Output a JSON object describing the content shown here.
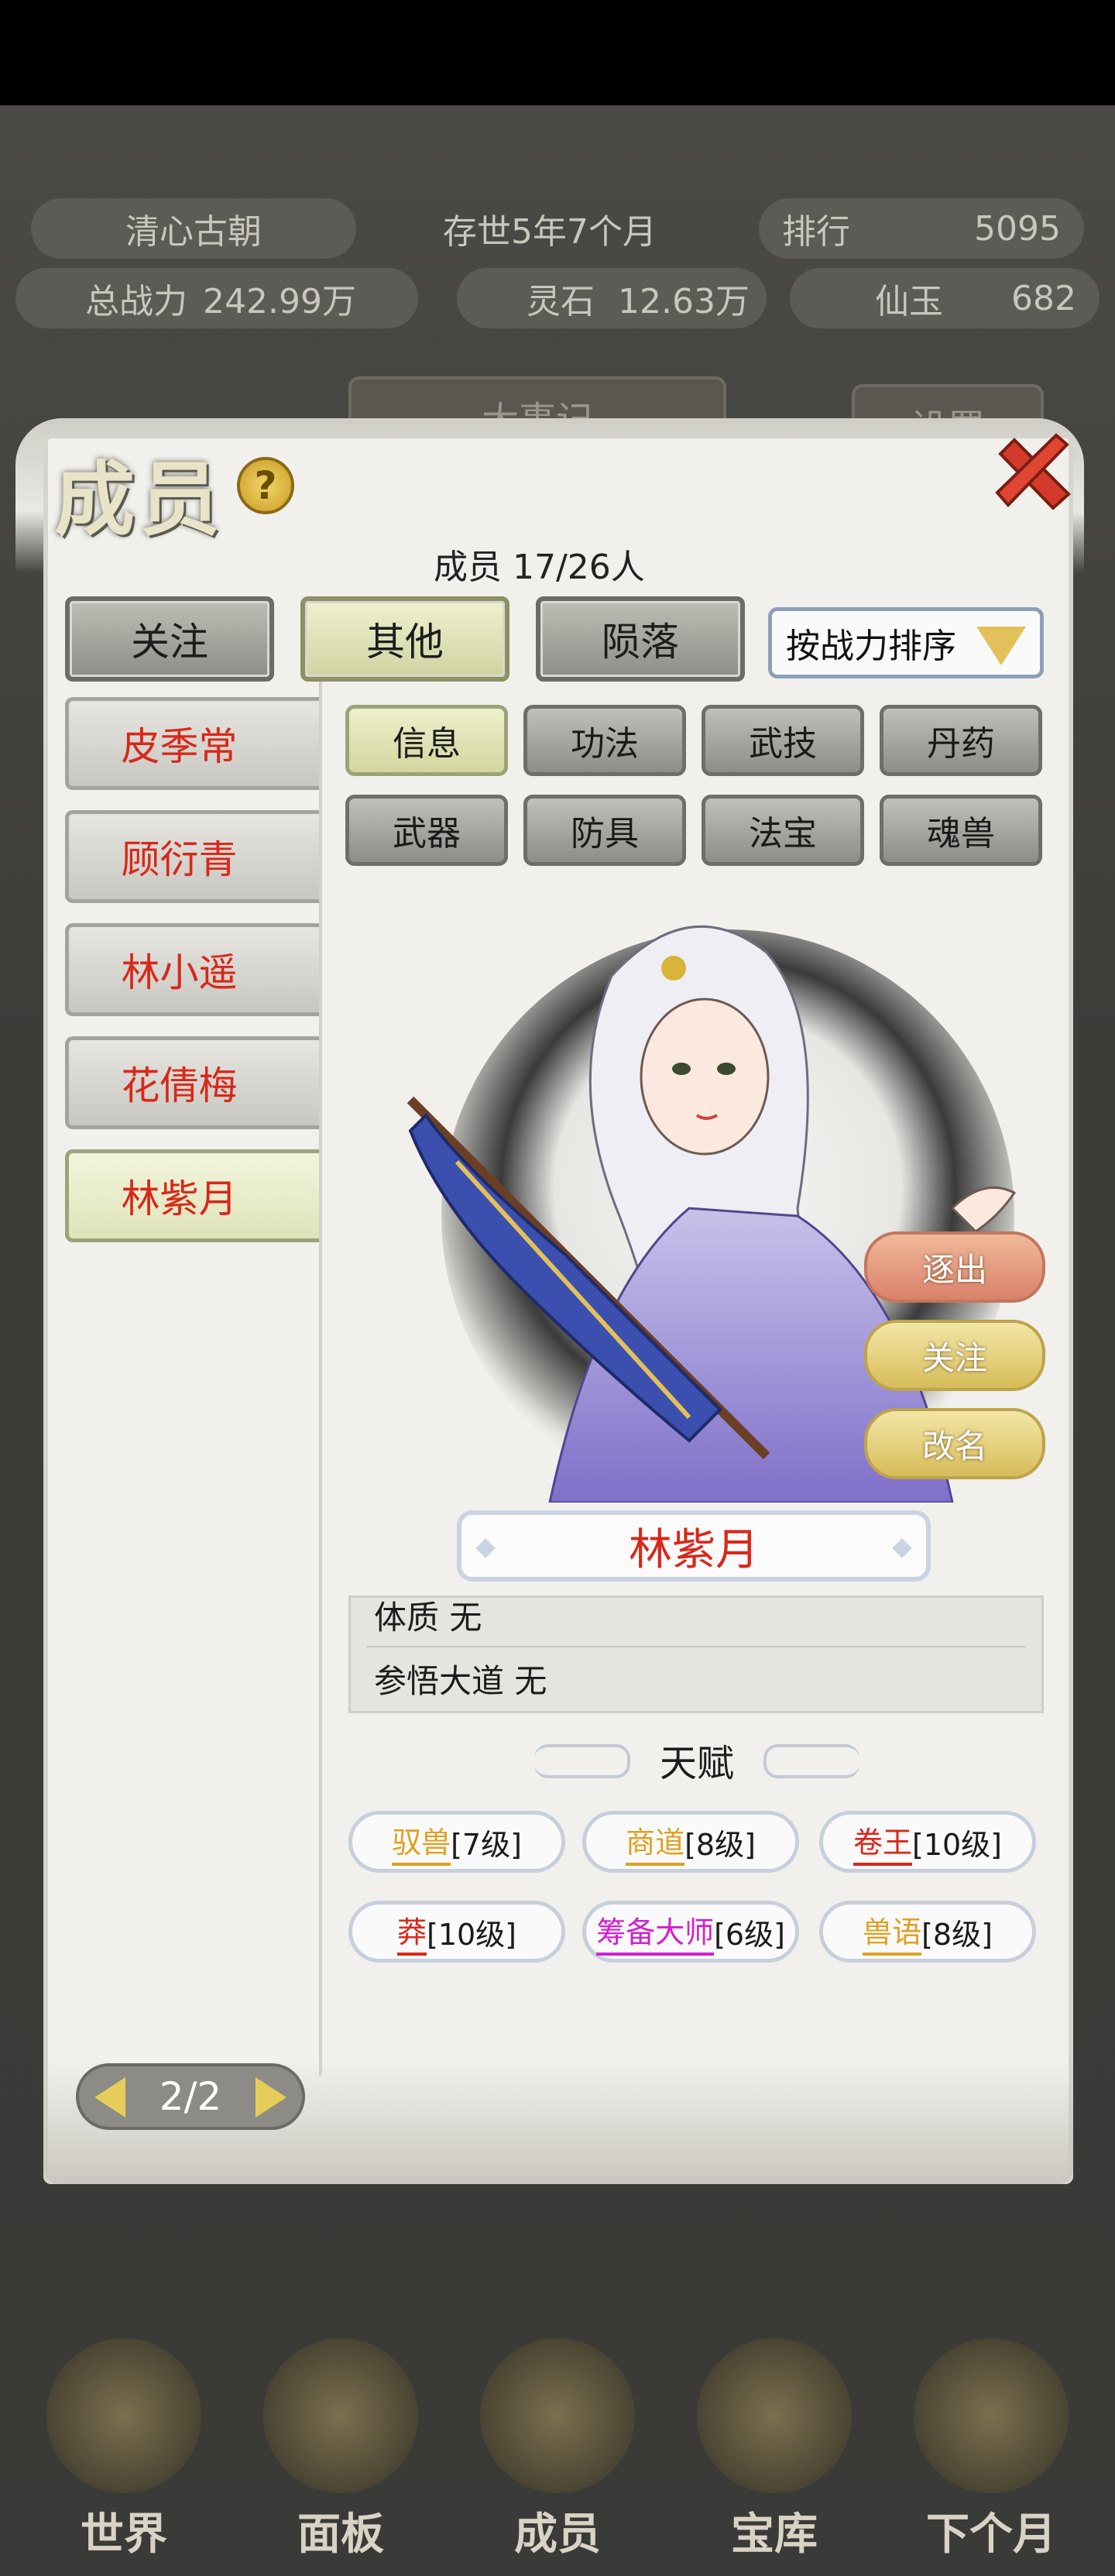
{
  "hud": {
    "sect_name": "清心古朝",
    "age": "存世5年7个月",
    "rank_label": "排行",
    "rank_value": "5095",
    "power_label": "总战力",
    "power_value": "242.99万",
    "spirit_stone_label": "灵石",
    "spirit_stone_value": "12.63万",
    "jade_label": "仙玉",
    "jade_value": "682",
    "events_tab": "大事记",
    "settings_tab": "设置",
    "bottom_nav": [
      "世界",
      "面板",
      "成员",
      "宝库",
      "下个月"
    ]
  },
  "panel": {
    "title": "成员",
    "help": "?",
    "member_count": "成员  17/26人",
    "tabs": [
      "关注",
      "其他",
      "陨落"
    ],
    "active_tab": 1,
    "sort_label": "按战力排序",
    "members": [
      "皮季常",
      "顾衍青",
      "林小遥",
      "花倩梅",
      "林紫月"
    ],
    "active_member": 4,
    "categories": [
      "信息",
      "功法",
      "武技",
      "丹药",
      "武器",
      "防具",
      "法宝",
      "魂兽"
    ],
    "active_category": 0,
    "actions": [
      "逐出",
      "关注",
      "改名"
    ],
    "selected_name": "林紫月",
    "info_lines": [
      "体质 无",
      "参悟大道 无"
    ],
    "talent_header": "天赋",
    "talents": [
      {
        "name": "驭兽",
        "level": "[7级]",
        "color": "#e0a020"
      },
      {
        "name": "商道",
        "level": "[8级]",
        "color": "#e0a020"
      },
      {
        "name": "卷王",
        "level": "[10级]",
        "color": "#d8281a"
      },
      {
        "name": "莽",
        "level": "[10级]",
        "color": "#d8281a"
      },
      {
        "name": "筹备大师",
        "level": "[6级]",
        "color": "#d020d0"
      },
      {
        "name": "兽语",
        "level": "[8级]",
        "color": "#e0a020"
      }
    ],
    "page": "2/2"
  }
}
